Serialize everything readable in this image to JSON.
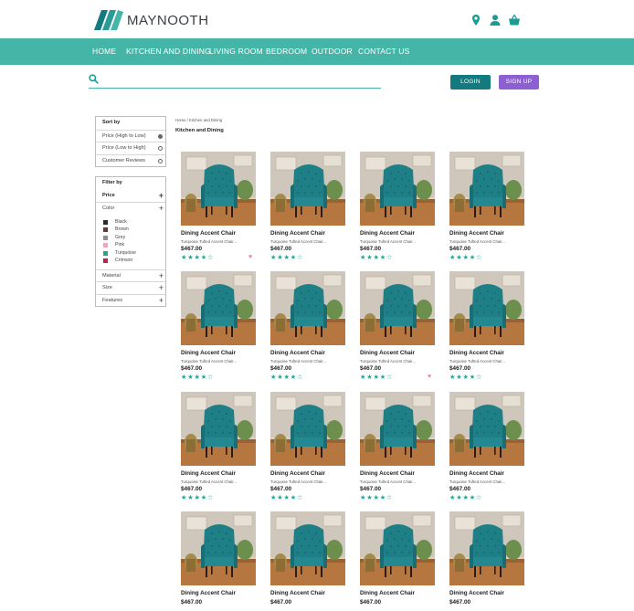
{
  "brand": {
    "name": "MAYNOOTH",
    "primary_color": "#45b5a7",
    "dark_teal": "#137a7f",
    "purple": "#8d5fd3",
    "logo_icon": "three-slanted-bars-logo"
  },
  "header_icons": [
    {
      "name": "location-pin-icon"
    },
    {
      "name": "user-icon"
    },
    {
      "name": "shopping-basket-icon"
    }
  ],
  "nav": {
    "items": [
      {
        "label": "HOME"
      },
      {
        "label": "KITCHEN AND DINING"
      },
      {
        "label": "LIVING ROOM"
      },
      {
        "label": "BEDROOM"
      },
      {
        "label": "OUTDOOR"
      },
      {
        "label": "CONTACT US"
      }
    ]
  },
  "search": {
    "value": "",
    "placeholder": ""
  },
  "auth": {
    "login_label": "LOGIN",
    "signup_label": "SIGN UP"
  },
  "sort": {
    "title": "Sort by",
    "options": [
      {
        "label": "Price (High to Low)",
        "selected": true
      },
      {
        "label": "Price (Low to High)",
        "selected": false
      },
      {
        "label": "Customer Reviews",
        "selected": false
      }
    ]
  },
  "filter": {
    "title": "Filter by",
    "price_label": "Price",
    "color_label": "Color",
    "colors": [
      {
        "label": "Black",
        "hex": "#2b2b2b"
      },
      {
        "label": "Brown",
        "hex": "#6b3b2a"
      },
      {
        "label": "Grey",
        "hex": "#8f8f8f"
      },
      {
        "label": "Pink",
        "hex": "#f2a3c4"
      },
      {
        "label": "Turquoise",
        "hex": "#1aa894"
      },
      {
        "label": "Crimson",
        "hex": "#c21e56"
      }
    ],
    "material_label": "Material",
    "size_label": "Size",
    "features_label": "Features"
  },
  "breadcrumb": "Home / Kitchen and Dining",
  "category_title": "Kitchen and Dining",
  "products": [
    {
      "name": "Dining Accent Chair",
      "desc": "Turquoise Tufted Accent Chair...",
      "price": "$467.00",
      "rating": 4,
      "favorited": true
    },
    {
      "name": "Dining Accent Chair",
      "desc": "Turquoise Tufted Accent Chair...",
      "price": "$467.00",
      "rating": 4,
      "favorited": false
    },
    {
      "name": "Dining Accent Chair",
      "desc": "Turquoise Tufted Accent Chair...",
      "price": "$467.00",
      "rating": 4,
      "favorited": false
    },
    {
      "name": "Dining Accent Chair",
      "desc": "Turquoise Tufted Accent Chair...",
      "price": "$467.00",
      "rating": 4,
      "favorited": false
    },
    {
      "name": "Dining Accent Chair",
      "desc": "Turquoise Tufted Accent Chair...",
      "price": "$467.00",
      "rating": 4,
      "favorited": false
    },
    {
      "name": "Dining Accent Chair",
      "desc": "Turquoise Tufted Accent Chair...",
      "price": "$467.00",
      "rating": 4,
      "favorited": false
    },
    {
      "name": "Dining Accent Chair",
      "desc": "Turquoise Tufted Accent Chair...",
      "price": "$467.00",
      "rating": 4,
      "favorited": true
    },
    {
      "name": "Dining Accent Chair",
      "desc": "Turquoise Tufted Accent Chair...",
      "price": "$467.00",
      "rating": 4,
      "favorited": false
    },
    {
      "name": "Dining Accent Chair",
      "desc": "Turquoise Tufted Accent Chair...",
      "price": "$467.00",
      "rating": 4,
      "favorited": false
    },
    {
      "name": "Dining Accent Chair",
      "desc": "Turquoise Tufted Accent Chair...",
      "price": "$467.00",
      "rating": 4,
      "favorited": false
    },
    {
      "name": "Dining Accent Chair",
      "desc": "Turquoise Tufted Accent Chair...",
      "price": "$467.00",
      "rating": 4,
      "favorited": false
    },
    {
      "name": "Dining Accent Chair",
      "desc": "Turquoise Tufted Accent Chair...",
      "price": "$467.00",
      "rating": 4,
      "favorited": false
    },
    {
      "name": "Dining Accent Chair",
      "desc": "",
      "price": "$467.00",
      "rating": 0,
      "favorited": false
    },
    {
      "name": "Dining Accent Chair",
      "desc": "",
      "price": "$467.00",
      "rating": 0,
      "favorited": false
    },
    {
      "name": "Dining Accent Chair",
      "desc": "",
      "price": "$467.00",
      "rating": 0,
      "favorited": false
    },
    {
      "name": "Dining Accent Chair",
      "desc": "",
      "price": "$467.00",
      "rating": 0,
      "favorited": false
    }
  ]
}
